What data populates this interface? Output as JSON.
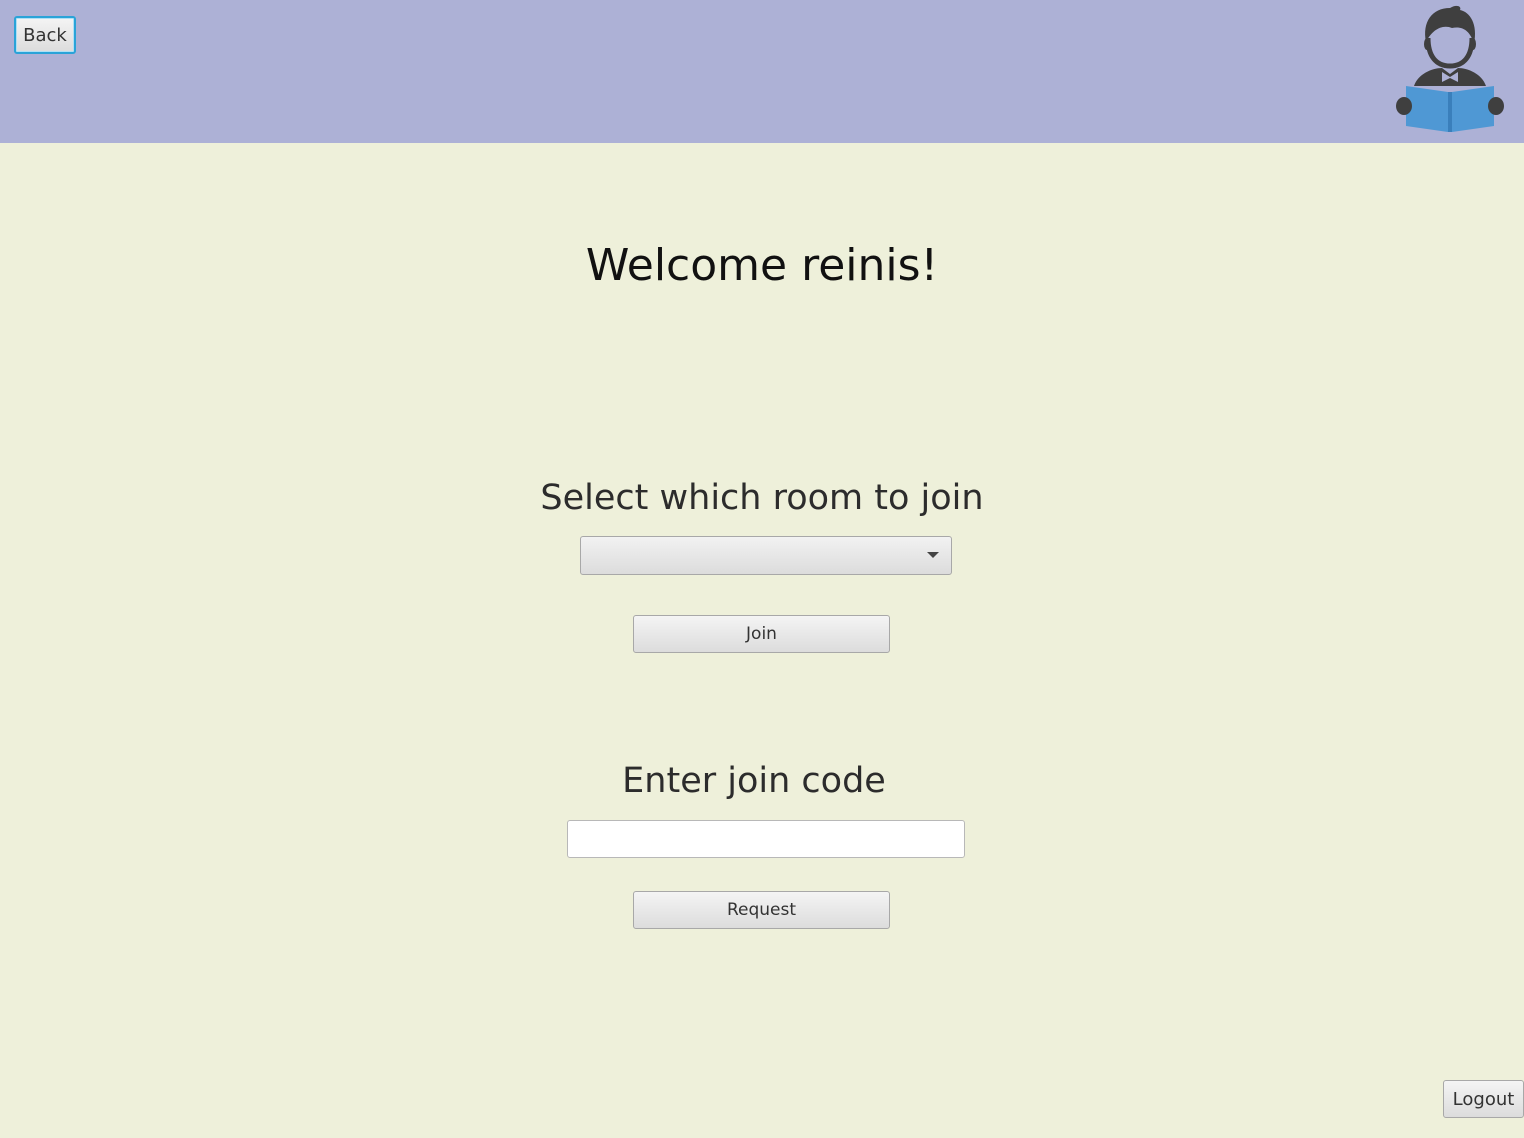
{
  "header": {
    "back_label": "Back",
    "avatar_icon": "reading-person-icon",
    "background_color": "#adb1d6"
  },
  "main": {
    "welcome_text": "Welcome reinis!",
    "room_section": {
      "label": "Select which room to join",
      "selected_value": "",
      "join_label": "Join"
    },
    "code_section": {
      "label": "Enter join code",
      "input_value": "",
      "input_placeholder": "",
      "request_label": "Request"
    }
  },
  "footer": {
    "logout_label": "Logout"
  },
  "colors": {
    "page_background": "#eef0da",
    "focus_accent": "#2aa3d8",
    "book_blue": "#4f98d4",
    "figure_gray": "#3f3f3f"
  }
}
